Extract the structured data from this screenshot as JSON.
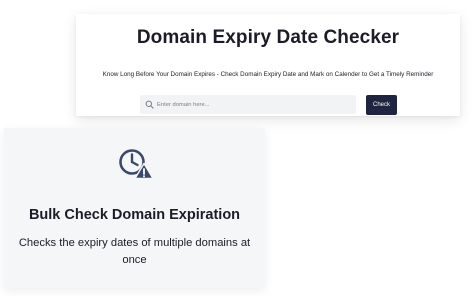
{
  "header_card": {
    "title": "Domain Expiry Date Checker",
    "subtitle": "Know Long Before Your Domain Expires - Check Domain Expiry Date and Mark on Calender to Get a Timely Reminder",
    "search": {
      "placeholder": "Enter domain here...",
      "value": "",
      "icon": "search-icon"
    },
    "check_button_label": "Check"
  },
  "feature_card": {
    "icon": "clock-warning-icon",
    "title": "Bulk Check Domain Expiration",
    "description": "Checks the expiry dates of multiple domains at once"
  },
  "colors": {
    "button_bg": "#1f2540",
    "icon_color": "#3b4a6b",
    "text": "#1c1c28",
    "card_bg": "#f5f6f8",
    "input_bg": "#f2f3f5"
  }
}
